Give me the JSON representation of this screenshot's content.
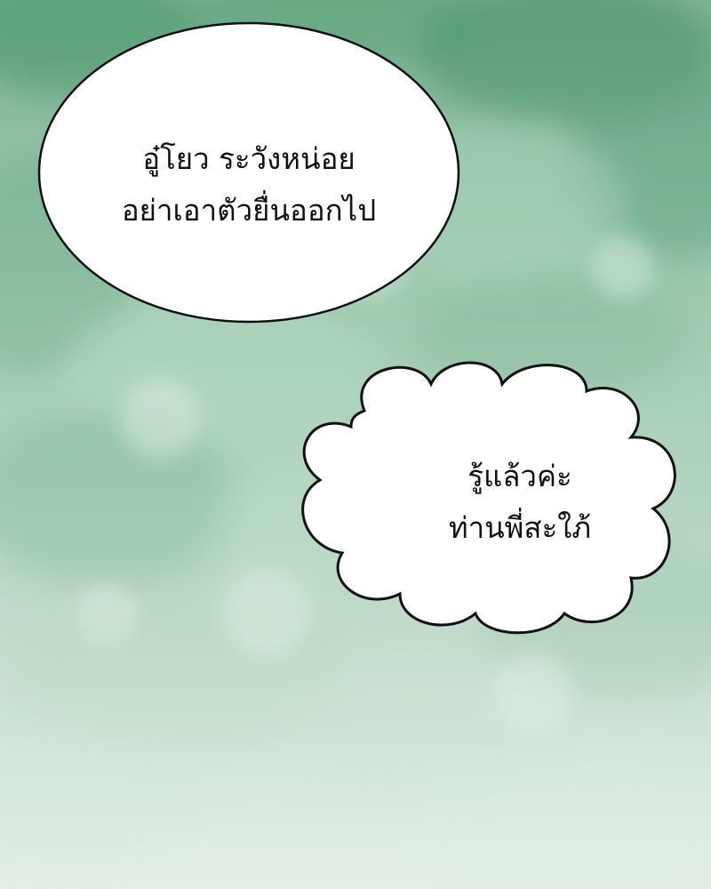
{
  "speech_bubble": {
    "lines": [
      "อู๋โยว ระวังหน่อย",
      "อย่าเอาตัวยื่นออกไป"
    ]
  },
  "thought_bubble": {
    "lines": [
      "รู้แล้วค่ะ",
      "ท่านพี่สะใภ้"
    ]
  },
  "colors": {
    "background_top": "#7fb496",
    "background_bottom": "#cfe2d4",
    "bubble_fill": "#ffffff",
    "bubble_outline": "#111111",
    "text": "#111111"
  }
}
